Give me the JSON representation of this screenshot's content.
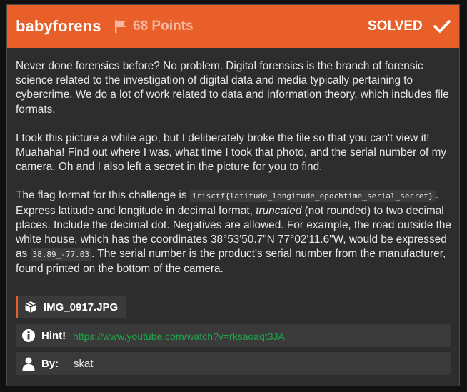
{
  "challenge": {
    "title": "babyforens",
    "points": "68 Points",
    "status": "SOLVED",
    "flag_icon": "flag-icon",
    "check_icon": "check-icon",
    "accent_color": "#e95f2a"
  },
  "description": {
    "p1": "Never done forensics before? No problem. Digital forensics is the branch of forensic science related to the investigation of digital data and media typically pertaining to cybercrime. We do a lot of work related to data and information theory, which includes file formats.",
    "p2": "I took this picture a while ago, but I deliberately broke the file so that you can't view it! Muahaha! Find out where I was, what time I took that photo, and the serial number of my camera. Oh and I also left a secret in the picture for you to find.",
    "p3_a": "The flag format for this challenge is ",
    "p3_code1": "irisctf{latitude_longitude_epochtime_serial_secret}",
    "p3_b": ". Express latitude and longitude in decimal format, ",
    "p3_em": "truncated",
    "p3_c": " (not rounded) to two decimal places. Include the decimal dot. Negatives are allowed. For example, the road outside the white house, which has the coordinates 38°53'50.7\"N 77°02'11.6\"W, would be expressed as ",
    "p3_code2": "38.89_-77.03",
    "p3_d": ". The serial number is the product's serial number from the manufacturer, found printed on the bottom of the camera."
  },
  "file": {
    "icon": "cube-icon",
    "name": "IMG_0917.JPG"
  },
  "hint": {
    "icon": "info-icon",
    "label": "Hint!",
    "link": "https://www.youtube.com/watch?v=rksaoaqt3JA",
    "link_color": "#1fa64a"
  },
  "author": {
    "icon": "user-icon",
    "label": "By:",
    "name": "skat"
  }
}
